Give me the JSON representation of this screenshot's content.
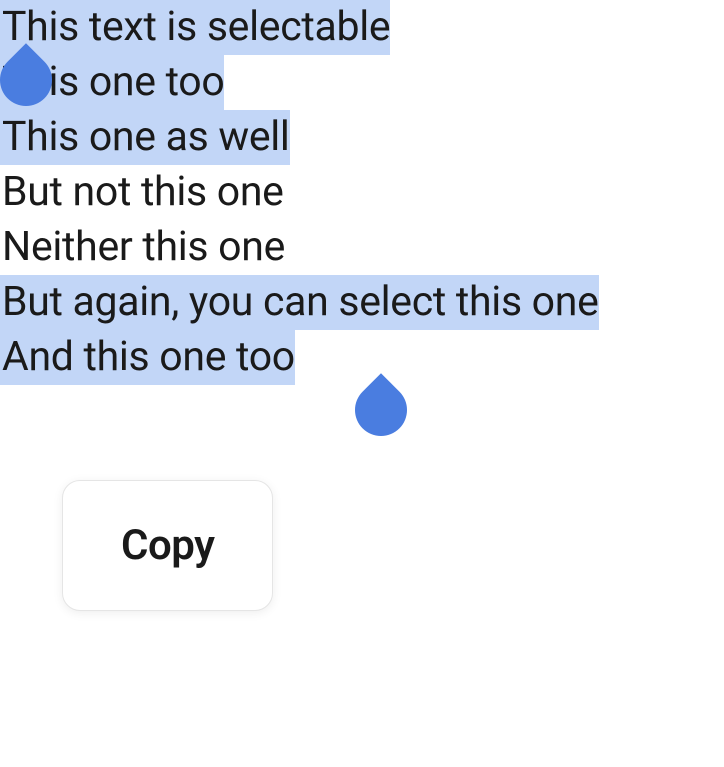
{
  "lines": {
    "line1": "This text is selectable",
    "line2": "This one too",
    "line3": "This one as well",
    "line4": "But not this one",
    "line5": "Neither this one",
    "line6": "But again, you can select this one",
    "line7": "And this one too"
  },
  "popup": {
    "copy_label": "Copy"
  },
  "colors": {
    "selection_bg": "#c2d6f7",
    "handle": "#4a7de0"
  }
}
